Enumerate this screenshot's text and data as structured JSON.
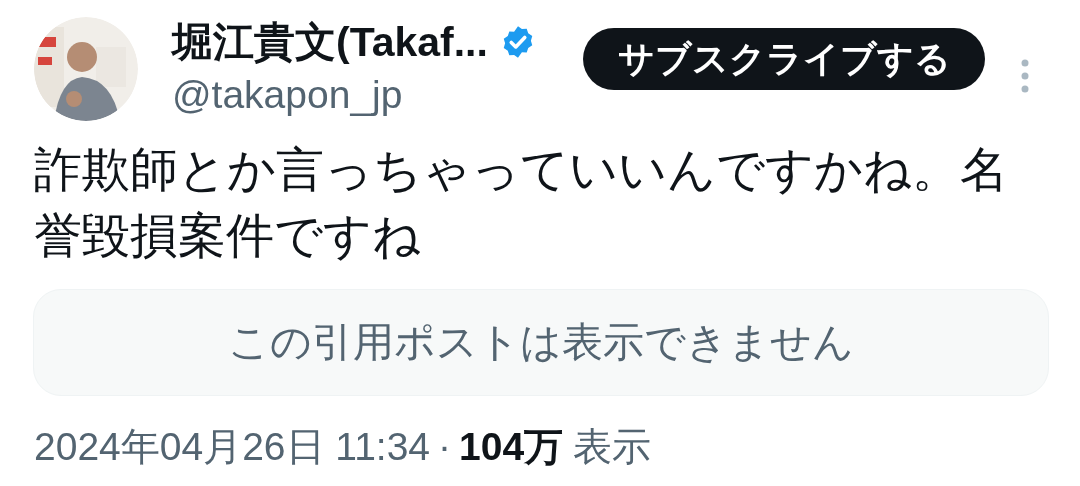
{
  "author": {
    "name": "堀江貴文(Takaf...",
    "verified": true,
    "handle": "@takapon_jp"
  },
  "subscribe_button": "サブスクライブする",
  "more_menu": true,
  "text": "詐欺師とか言っちゃっていいんですかね。名誉毀損案件ですね",
  "quote": {
    "message": "この引用ポストは表示できません"
  },
  "footer": {
    "timestamp": "2024年04月26日 11:34",
    "separator": "·",
    "views_count": "104万",
    "views_label": "表示"
  }
}
